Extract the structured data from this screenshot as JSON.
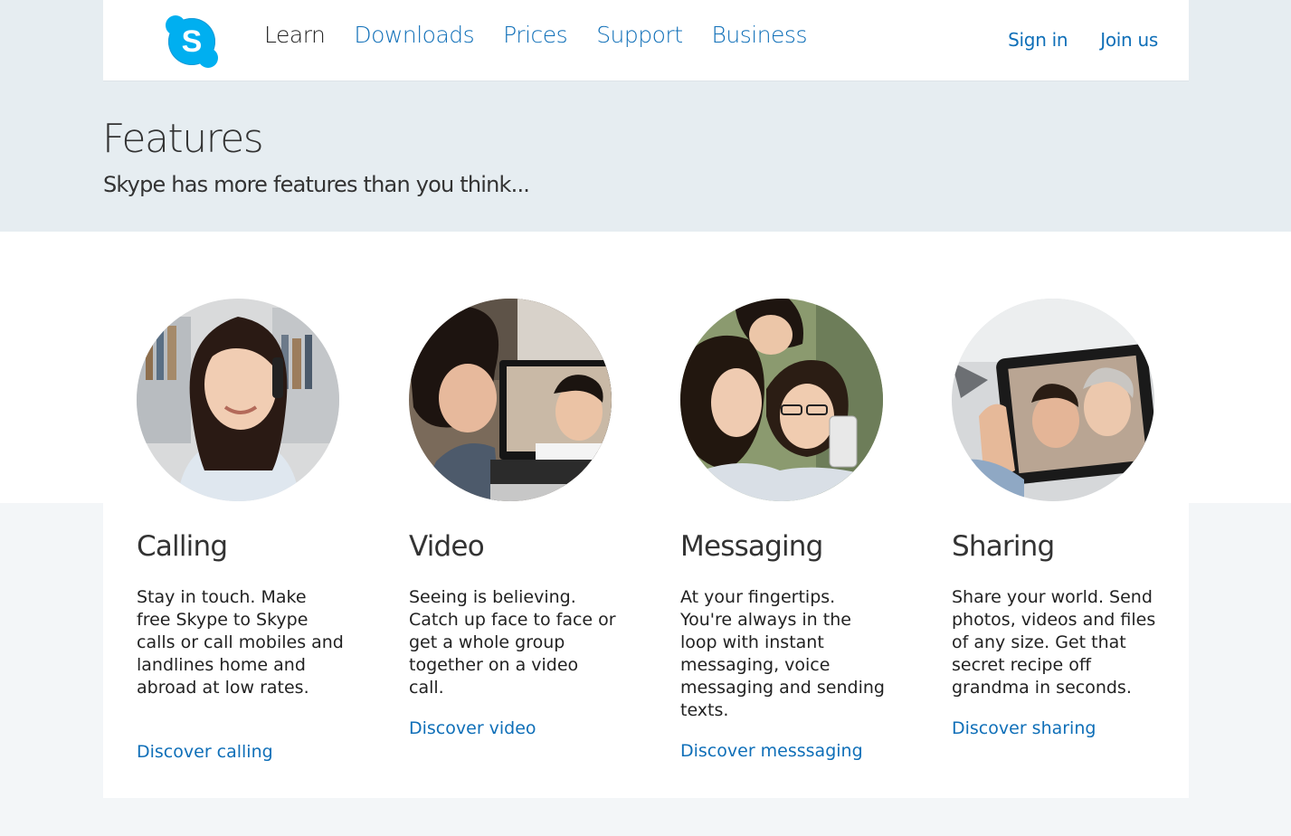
{
  "nav": {
    "logo_letter": "S",
    "links": [
      {
        "label": "Learn",
        "active": true
      },
      {
        "label": "Downloads",
        "active": false
      },
      {
        "label": "Prices",
        "active": false
      },
      {
        "label": "Support",
        "active": false
      },
      {
        "label": "Business",
        "active": false
      }
    ],
    "sign_in": "Sign in",
    "join_us": "Join us"
  },
  "hero": {
    "title": "Features",
    "subtitle": "Skype has more features than you think..."
  },
  "features": [
    {
      "title": "Calling",
      "description": "Stay in touch. Make free Skype to Skype calls or call mobiles and landlines home and abroad at low rates.",
      "link": "Discover calling"
    },
    {
      "title": "Video",
      "description": "Seeing is believing. Catch up face to face or get a whole group together on a video call.",
      "link": "Discover video"
    },
    {
      "title": "Messaging",
      "description": "At your fingertips. You're always in the loop with instant messaging, voice messaging and sending texts.",
      "link": "Discover messsaging"
    },
    {
      "title": "Sharing",
      "description": "Share your world. Send photos, videos and files of any size. Get that secret recipe off grandma in seconds.",
      "link": "Discover sharing"
    }
  ],
  "colors": {
    "brand": "#00aff0",
    "link": "#0f6fb8",
    "header_band": "#e6edf1"
  }
}
